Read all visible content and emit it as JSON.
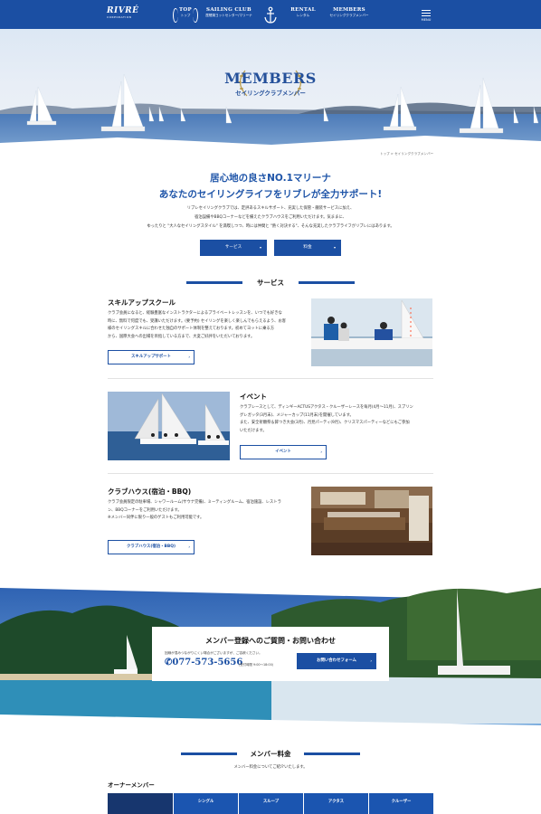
{
  "header": {
    "logo_name": "RIVRÉ",
    "logo_sub": "CORPORATION",
    "nav": [
      {
        "en": "TOP",
        "jp": "トップ"
      },
      {
        "en": "SAILING CLUB",
        "jp": "琵琶湖ヨットセンター/マリーナ"
      },
      {
        "en": "RENTAL",
        "jp": "レンタル"
      },
      {
        "en": "MEMBERS",
        "jp": "セイリングクラブメンバー"
      }
    ],
    "menu_label": "MENU"
  },
  "hero": {
    "title": "MEMBERS",
    "subtitle": "セイリングクラブメンバー"
  },
  "breadcrumb": "トップ > セイリングクラブメンバー",
  "intro": {
    "heading_1": "居心地の良さNO.1マリーナ",
    "heading_2": "あなたのセイリングライフをリブレが全力サポート!",
    "body": [
      "リブレセイリングクラブでは、定評あるスキルサポート、充実した保管・艤装サービスに加え、",
      "宿泊設備やBBQコーナーなどを備えたクラブハウスをご利用いただけます。気ままに、",
      "ゆったりと \"大人なセイリングスタイル\" を満喫しつつ、時には仲間と \"熱く対決する\"、そんな充実したクラブライフがリブレにはあります。"
    ],
    "btn_service": "サービス",
    "btn_fee": "料金"
  },
  "services": {
    "title": "サービス",
    "skill": {
      "heading": "スキルアップスクール",
      "body": [
        "クラブ会員になると、経験豊富なインストラクターによるプライベートレッスンを、いつでも好きな",
        "時に、無料で何度でも、受講いただけます。(要予約) セイリングを楽しく楽しんでもらえるよう、お客",
        "様のセイリングスキルに合わせた独自のサポート体制を整えております。初めてヨットに乗る方",
        "から、国際大会への出場を目指している方まで、大変ご好評をいただいております。"
      ],
      "button": "スキルアップサポート"
    },
    "event": {
      "heading": "イベント",
      "body": [
        "クラブレースとして、ディンギーACTUSアクタス・クルーザーレースを毎月(4月〜11月)、スプリン",
        "グレガッタ(3月末)、メジャーカップ(11月末)を開催しています。",
        "また、安全祈願祭＆鉾つき大会(3月)、月見パーティ(9月)、クリスマスパーティーなどにもご参加",
        "いただけます。"
      ],
      "button": "イベント"
    },
    "clubhouse": {
      "heading": "クラブハウス(宿泊・BBQ)",
      "body": [
        "クラブ会員限定の駐車場、シャワールーム(サウナ完備)、ミーティングルーム、宿泊施設、レストラ",
        "ン、BBQコーナーをご利用いただけます。",
        "※メンバー同伴に限り一般のゲストもご利用可能です。"
      ],
      "button": "クラブハウス(宿泊・BBQ)"
    }
  },
  "contact": {
    "title": "メンバー登録へのご質問・お問い合わせ",
    "note": "回線が混みつながりにくい場合がございますが、ご容赦ください。",
    "phone": "077-573-5656",
    "hours": "(受付時間 9:00〜18:00)",
    "button": "お問い合わせフォーム"
  },
  "fees": {
    "title": "メンバー料金",
    "subtitle": "メンバー料金についてご紹介いたします。",
    "owner_heading": "オーナーメンバー",
    "columns": [
      "シングル",
      "スループ",
      "アクタス",
      "クルーザー"
    ]
  },
  "colors": {
    "brand_blue": "#1b4fa3",
    "heading_blue": "#1e54a8",
    "table_dark": "#17366e"
  }
}
